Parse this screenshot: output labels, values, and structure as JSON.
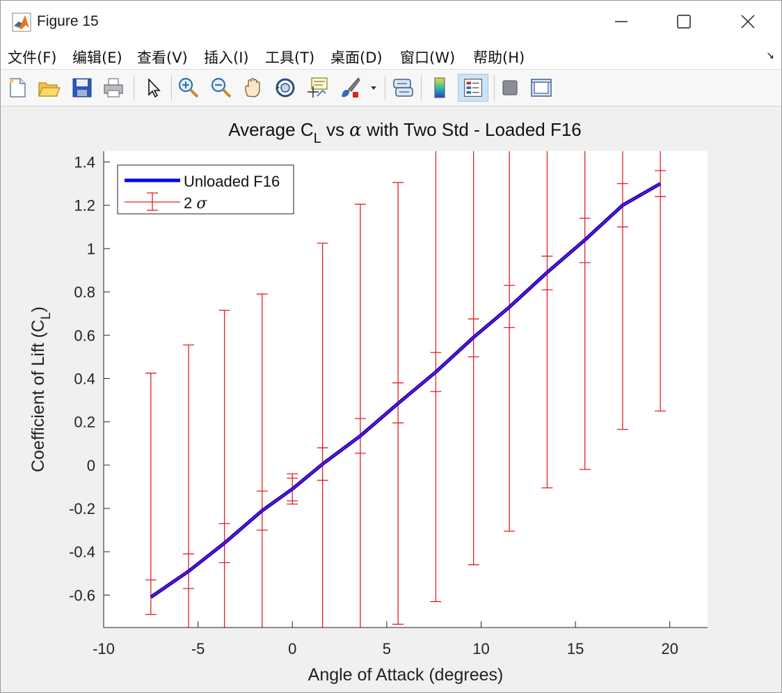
{
  "window": {
    "title": "Figure 15"
  },
  "menu": {
    "items": [
      "文件(F)",
      "编辑(E)",
      "查看(V)",
      "插入(I)",
      "工具(T)",
      "桌面(D)",
      "窗口(W)",
      "帮助(H)"
    ]
  },
  "toolbar": {
    "icons": [
      "new-figure-icon",
      "open-icon",
      "save-icon",
      "print-icon",
      "pointer-icon",
      "zoom-in-icon",
      "zoom-out-icon",
      "pan-hand-icon",
      "rotate-3d-icon",
      "data-cursor-icon",
      "brush-icon",
      "brush-dropdown-icon",
      "link-plot-icon",
      "colorbar-icon",
      "legend-icon",
      "hide-plot-tools-icon",
      "show-plot-tools-icon"
    ]
  },
  "chart_data": {
    "type": "line",
    "title_main": "Average C",
    "title_sub": "L",
    "title_alpha": "α",
    "title_rest_a": " vs ",
    "title_rest_b": " with Two Std - Loaded F16",
    "xlabel": "Angle of Attack (degrees)",
    "ylabel_main": "Coefficient of Lift (C",
    "ylabel_sub": "L",
    "ylabel_close": ")",
    "xlim": [
      -10,
      22
    ],
    "ylim": [
      -0.75,
      1.45
    ],
    "xticks": [
      -10,
      -5,
      0,
      5,
      10,
      15,
      20
    ],
    "xtick_labels": [
      "-10",
      "-5",
      "0",
      "5",
      "10",
      "15",
      "20"
    ],
    "yticks": [
      -0.6,
      -0.4,
      -0.2,
      0,
      0.2,
      0.4,
      0.6,
      0.8,
      1,
      1.2,
      1.4
    ],
    "ytick_labels": [
      "-0.6",
      "-0.4",
      "-0.2",
      "0",
      "0.2",
      "0.4",
      "0.6",
      "0.8",
      "1",
      "1.2",
      "1.4"
    ],
    "grid": false,
    "legend_position": "top-left",
    "series": [
      {
        "name": "Unloaded F16",
        "color": "#0000ff",
        "x": [
          -7.5,
          -5.5,
          -3.6,
          -1.6,
          0,
          1.6,
          3.6,
          5.6,
          7.6,
          9.6,
          11.5,
          13.5,
          15.5,
          17.5,
          19.5
        ],
        "y": [
          -0.61,
          -0.49,
          -0.36,
          -0.21,
          -0.11,
          0.005,
          0.135,
          0.285,
          0.43,
          0.59,
          0.73,
          0.89,
          1.04,
          1.2,
          1.3
        ]
      }
    ],
    "errorbars": {
      "name": "2 σ",
      "legend_number": "2",
      "legend_sigma": "σ",
      "color": "#e02020",
      "x": [
        -7.5,
        -5.5,
        -3.6,
        -1.6,
        0,
        1.6,
        3.6,
        5.6,
        7.6,
        9.6,
        11.5,
        13.5,
        15.5,
        17.5,
        19.5
      ],
      "outer_lower": [
        -0.69,
        -0.75,
        -0.75,
        -0.75,
        -0.18,
        -0.75,
        -0.75,
        -0.735,
        -0.63,
        -0.46,
        -0.305,
        -0.105,
        -0.02,
        0.165,
        0.25
      ],
      "outer_upper": [
        0.425,
        0.555,
        0.715,
        0.79,
        -0.04,
        1.025,
        1.205,
        1.305,
        1.45,
        1.45,
        1.45,
        1.45,
        1.45,
        1.45,
        1.45
      ],
      "inner_lower": [
        null,
        -0.57,
        -0.45,
        -0.3,
        -0.165,
        -0.07,
        0.055,
        0.195,
        0.34,
        0.5,
        0.635,
        0.81,
        0.935,
        1.1,
        1.24
      ],
      "inner_upper": [
        -0.53,
        -0.41,
        -0.27,
        -0.12,
        -0.06,
        0.08,
        0.215,
        0.38,
        0.52,
        0.675,
        0.83,
        0.965,
        1.14,
        1.3,
        1.36
      ]
    }
  }
}
